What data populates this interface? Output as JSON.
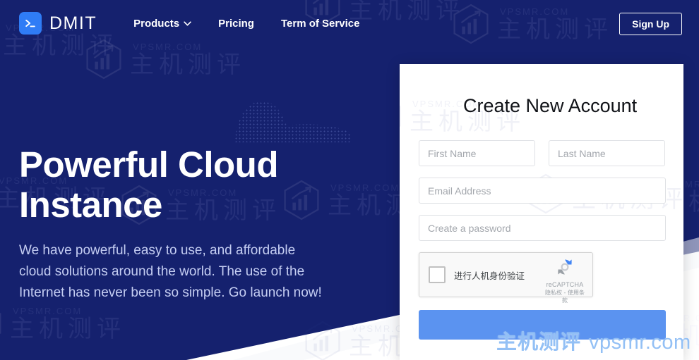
{
  "header": {
    "logo_icon": "terminal-prompt-icon",
    "brand": "DMIT",
    "nav": [
      {
        "label": "Products",
        "has_dropdown": true,
        "icon": "chevron-down-icon"
      },
      {
        "label": "Pricing",
        "has_dropdown": false
      },
      {
        "label": "Term of Service",
        "has_dropdown": false
      }
    ],
    "signup_label": "Sign Up"
  },
  "hero": {
    "title_line1": "Powerful Cloud",
    "title_line2": "Instance",
    "paragraph": "We have powerful, easy to use, and affordable cloud solutions around the world. The use of the Internet has never been so simple. Go launch now!"
  },
  "signup_card": {
    "title": "Create New Account",
    "fields": {
      "first_name_placeholder": "First Name",
      "last_name_placeholder": "Last Name",
      "email_placeholder": "Email Address",
      "password_placeholder": "Create a password"
    },
    "recaptcha": {
      "label": "进行人机身份验证",
      "brand": "reCAPTCHA",
      "terms": "隐私权 - 使用条款",
      "logo_icon": "recaptcha-arrows-icon"
    },
    "submit_label": ""
  },
  "watermarks": {
    "english": "VPSMR.COM",
    "chinese": "主机测评",
    "foreground_cn": "主机测评",
    "foreground_en": "vpsmr.com"
  },
  "colors": {
    "navy": "#15216e",
    "accent_blue": "#2f7cf6",
    "button_blue": "#5b93f0",
    "hero_text": "#c4cdf2",
    "watermark_blue": "#93c0f5"
  }
}
